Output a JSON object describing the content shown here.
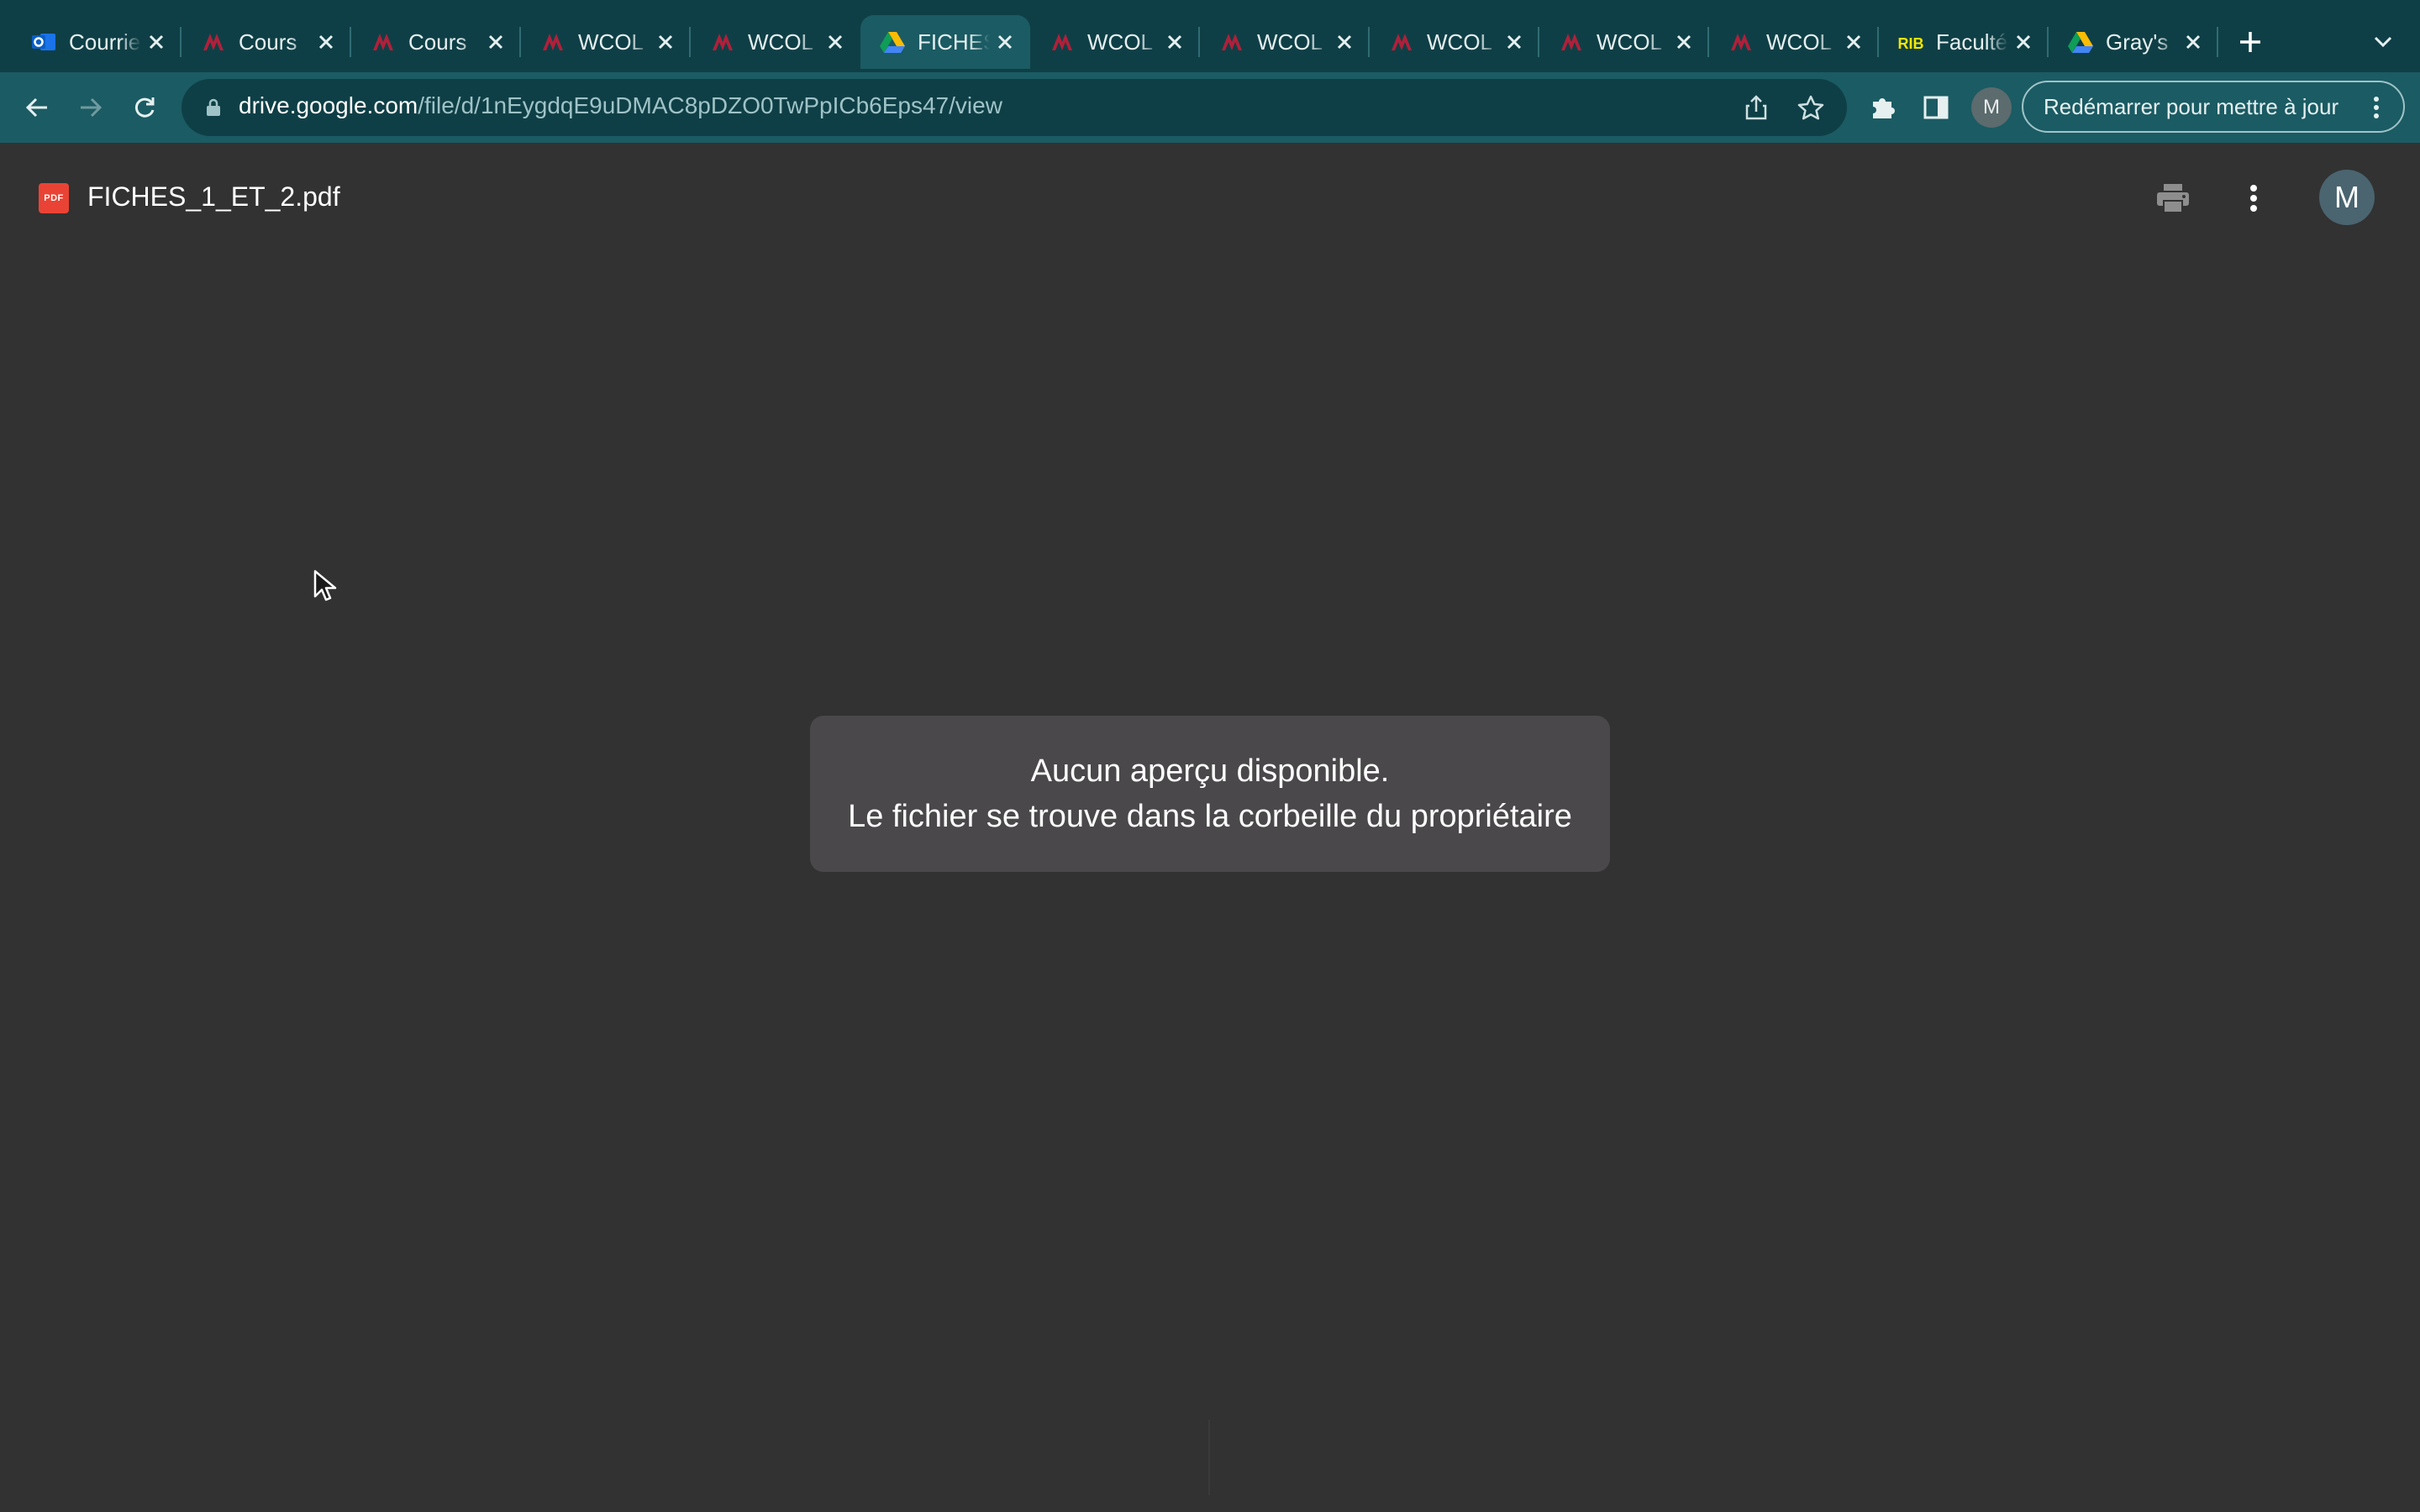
{
  "browser": {
    "tabs": [
      {
        "title": "Courrier",
        "icon": "outlook-icon",
        "active": false
      },
      {
        "title": "Cours",
        "icon": "uottawa-icon",
        "active": false
      },
      {
        "title": "Cours",
        "icon": "uottawa-icon",
        "active": false
      },
      {
        "title": "WCOL",
        "icon": "uottawa-icon",
        "active": false
      },
      {
        "title": "WCOL",
        "icon": "uottawa-icon",
        "active": false
      },
      {
        "title": "FICHES",
        "icon": "google-drive-icon",
        "active": true
      },
      {
        "title": "WCOL",
        "icon": "uottawa-icon",
        "active": false
      },
      {
        "title": "WCOL",
        "icon": "uottawa-icon",
        "active": false
      },
      {
        "title": "WCOL",
        "icon": "uottawa-icon",
        "active": false
      },
      {
        "title": "WCOL",
        "icon": "uottawa-icon",
        "active": false
      },
      {
        "title": "WCOL",
        "icon": "uottawa-icon",
        "active": false
      },
      {
        "title": "Faculté",
        "icon": "rib-icon",
        "active": false
      },
      {
        "title": "Gray's",
        "icon": "google-drive-icon",
        "active": false
      }
    ],
    "url_host": "drive.google.com",
    "url_path": "/file/d/1nEygdqE9uDMAC8pDZO0TwPpICb6Eps47/view",
    "profile_initial": "M",
    "update_button_label": "Redémarrer pour mettre à jour"
  },
  "viewer": {
    "file_name": "FICHES_1_ET_2.pdf",
    "file_type_badge": "PDF",
    "avatar_initial": "M"
  },
  "message": {
    "line1": "Aucun aperçu disponible.",
    "line2": "Le fichier se trouve dans la corbeille du propriétaire"
  },
  "colors": {
    "tabstrip_bg": "#0f3f46",
    "toolbar_bg": "#1b5b63",
    "page_bg": "#323232",
    "message_bg": "#4a484a",
    "pdf_red": "#ea4335"
  }
}
